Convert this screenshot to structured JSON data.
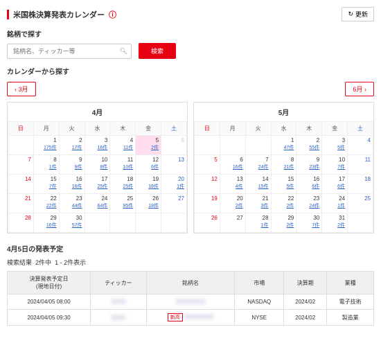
{
  "header": {
    "title": "米国株決算発表カレンダー",
    "refresh": "更新"
  },
  "search": {
    "section_title": "銘柄で探す",
    "placeholder": "銘柄名、ティッカー等",
    "button": "検索"
  },
  "cal_section": "カレンダーから探す",
  "nav": {
    "prev": "3月",
    "next": "6月"
  },
  "dow": [
    "日",
    "月",
    "火",
    "水",
    "木",
    "金",
    "土"
  ],
  "months": [
    {
      "title": "4月",
      "weeks": [
        [
          null,
          {
            "d": 1,
            "c": "175件"
          },
          {
            "d": 2,
            "c": "17件"
          },
          {
            "d": 3,
            "c": "16件"
          },
          {
            "d": 4,
            "c": "11件"
          },
          {
            "d": 5,
            "c": "2件",
            "sel": true
          },
          {
            "d": 6,
            "dim": true
          }
        ],
        [
          {
            "d": 7,
            "sun": true
          },
          {
            "d": 8,
            "c": "1件"
          },
          {
            "d": 9,
            "c": "9件"
          },
          {
            "d": 10,
            "c": "8件"
          },
          {
            "d": 11,
            "c": "10件"
          },
          {
            "d": 12,
            "c": "6件"
          },
          {
            "d": 13,
            "sat": true
          }
        ],
        [
          {
            "d": 14,
            "sun": true
          },
          {
            "d": 15,
            "c": "7件"
          },
          {
            "d": 16,
            "c": "16件"
          },
          {
            "d": 17,
            "c": "25件"
          },
          {
            "d": 18,
            "c": "25件"
          },
          {
            "d": 19,
            "c": "18件"
          },
          {
            "d": 20,
            "sat": true,
            "c": "1件"
          }
        ],
        [
          {
            "d": 21,
            "sun": true
          },
          {
            "d": 22,
            "c": "22件"
          },
          {
            "d": 23,
            "c": "44件"
          },
          {
            "d": 24,
            "c": "64件"
          },
          {
            "d": 25,
            "c": "95件"
          },
          {
            "d": 26,
            "c": "18件"
          },
          {
            "d": 27,
            "sat": true
          }
        ],
        [
          {
            "d": 28,
            "sun": true
          },
          {
            "d": 29,
            "c": "16件"
          },
          {
            "d": 30,
            "c": "57件"
          },
          null,
          null,
          null,
          null
        ]
      ]
    },
    {
      "title": "5月",
      "weeks": [
        [
          null,
          null,
          null,
          {
            "d": 1,
            "c": "47件"
          },
          {
            "d": 2,
            "c": "55件"
          },
          {
            "d": 3,
            "c": "5件"
          },
          {
            "d": 4,
            "sat": true
          }
        ],
        [
          {
            "d": 5,
            "sun": true
          },
          {
            "d": 6,
            "c": "16件"
          },
          {
            "d": 7,
            "c": "24件"
          },
          {
            "d": 8,
            "c": "21件"
          },
          {
            "d": 9,
            "c": "23件"
          },
          {
            "d": 10,
            "c": "7件"
          },
          {
            "d": 11,
            "sat": true
          }
        ],
        [
          {
            "d": 12,
            "sun": true
          },
          {
            "d": 13,
            "c": "4件"
          },
          {
            "d": 14,
            "c": "15件"
          },
          {
            "d": 15,
            "c": "5件"
          },
          {
            "d": 16,
            "c": "6件"
          },
          {
            "d": 17,
            "c": "6件"
          },
          {
            "d": 18,
            "sat": true
          }
        ],
        [
          {
            "d": 19,
            "sun": true
          },
          {
            "d": 20,
            "c": "2件"
          },
          {
            "d": 21,
            "c": "3件"
          },
          {
            "d": 22,
            "c": "2件"
          },
          {
            "d": 23,
            "c": "24件"
          },
          {
            "d": 24,
            "c": "1件"
          },
          {
            "d": 25,
            "sat": true
          }
        ],
        [
          {
            "d": 26,
            "sun": true
          },
          {
            "d": 27
          },
          {
            "d": 28,
            "c": "1件"
          },
          {
            "d": 29,
            "c": "2件"
          },
          {
            "d": 30,
            "c": "7件"
          },
          {
            "d": 31,
            "c": "2件"
          },
          null
        ]
      ]
    }
  ],
  "results": {
    "title": "4月5日の発表予定",
    "info_a": "検索結果",
    "info_b": "2件中",
    "info_c": "1 - 2件表示",
    "cols": [
      "決算発表予定日\n(現地日付)",
      "ティッカー",
      "銘柄名",
      "市場",
      "決算期",
      "業種"
    ],
    "rows": [
      {
        "date": "2024/04/05 08:00",
        "tag": "",
        "market": "NASDAQ",
        "term": "2024/02",
        "ind": "電子技術"
      },
      {
        "date": "2024/04/05 09:30",
        "tag": "新高",
        "market": "NYSE",
        "term": "2024/02",
        "ind": "製造業"
      }
    ]
  }
}
